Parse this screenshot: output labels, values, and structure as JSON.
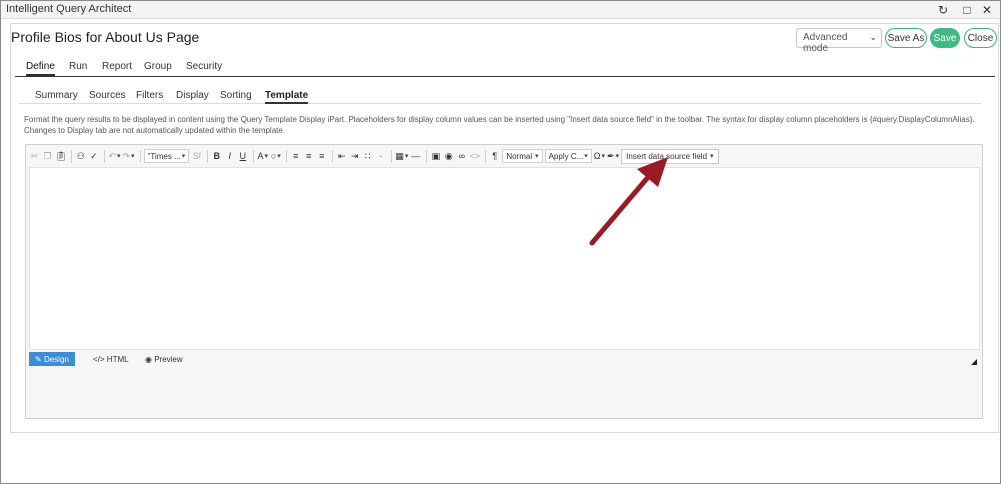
{
  "window": {
    "title": "Intelligent Query Architect"
  },
  "page": {
    "title": "Profile Bios for About Us Page"
  },
  "header": {
    "mode_label": "Advanced mode",
    "save_as_label": "Save As",
    "save_label": "Save",
    "close_label": "Close"
  },
  "main_tabs": [
    "Define",
    "Run",
    "Report",
    "Group",
    "Security"
  ],
  "sub_tabs": [
    "Summary",
    "Sources",
    "Filters",
    "Display",
    "Sorting",
    "Template"
  ],
  "help_text": "Format the query results to be displayed in content using the Query Template Display iPart. Placeholders for display column values can be inserted using \"Insert data source field\" in the toolbar. The syntax for display column placeholders is {#query.DisplayColumnAlias}. Changes to Display tab are not automatically updated within the template.",
  "toolbar": {
    "font_name": "\"Times ...",
    "paragraph_format": "Normal",
    "apply_css": "Apply C...",
    "insert_field": "Insert data source field"
  },
  "editor_modes": {
    "design": "Design",
    "html": "HTML",
    "preview": "Preview"
  },
  "colors": {
    "accent_green": "#3fba82",
    "design_active": "#3a8ed6",
    "annotation_arrow": "#9b1b24"
  }
}
